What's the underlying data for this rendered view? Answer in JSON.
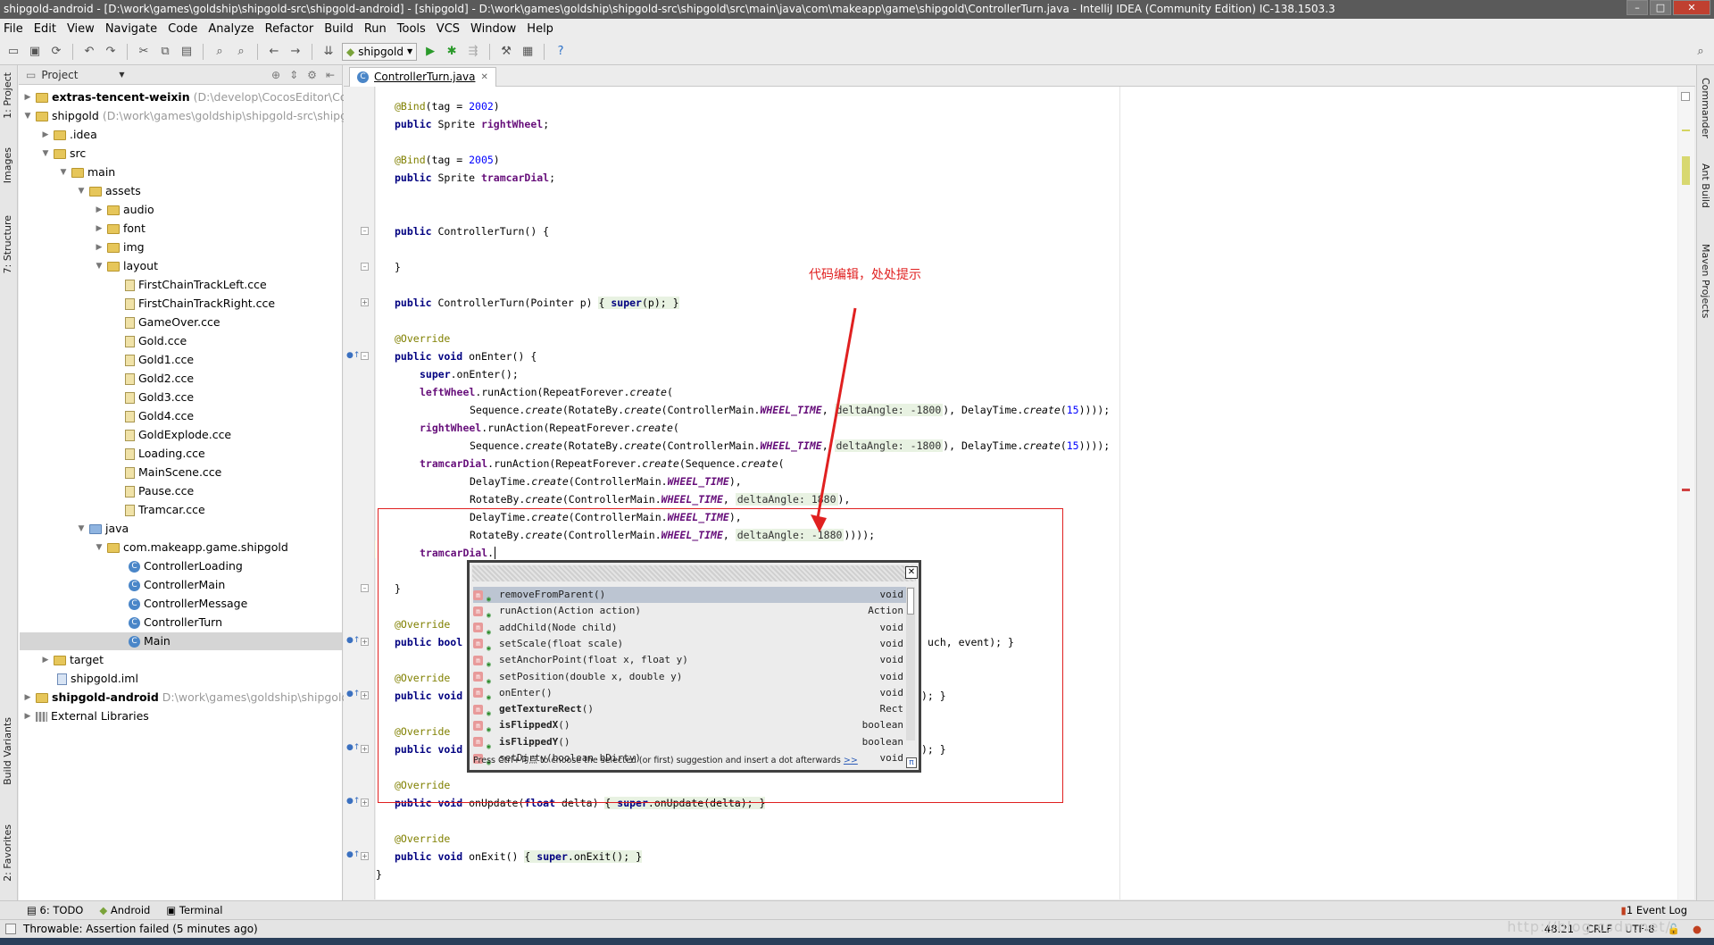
{
  "window": {
    "title": "shipgold-android - [D:\\work\\games\\goldship\\shipgold-src\\shipgold-android] - [shipgold] - D:\\work\\games\\goldship\\shipgold-src\\shipgold\\src\\main\\java\\com\\makeapp\\game\\shipgold\\ControllerTurn.java - IntelliJ IDEA (Community Edition) IC-138.1503.3"
  },
  "menu": [
    "File",
    "Edit",
    "View",
    "Navigate",
    "Code",
    "Analyze",
    "Refactor",
    "Build",
    "Run",
    "Tools",
    "VCS",
    "Window",
    "Help"
  ],
  "toolbar": {
    "run_config": "shipgold"
  },
  "left_tabs": [
    "1: Project",
    "Images",
    "7: Structure",
    "Build Variants",
    "2: Favorites"
  ],
  "right_tabs": [
    "Commander",
    "Ant Build",
    "Maven Projects"
  ],
  "project": {
    "header": "Project",
    "tree": [
      {
        "label": "extras-tencent-weixin",
        "path": "(D:\\develop\\CocosEditor\\Cocos",
        "bold": true
      },
      {
        "label": "shipgold",
        "path": "(D:\\work\\games\\goldship\\shipgold-src\\shipg",
        "bold": false
      },
      {
        "label": ".idea"
      },
      {
        "label": "src"
      },
      {
        "label": "main"
      },
      {
        "label": "assets"
      },
      {
        "label": "audio"
      },
      {
        "label": "font"
      },
      {
        "label": "img"
      },
      {
        "label": "layout"
      },
      {
        "label": "FirstChainTrackLeft.cce"
      },
      {
        "label": "FirstChainTrackRight.cce"
      },
      {
        "label": "GameOver.cce"
      },
      {
        "label": "Gold.cce"
      },
      {
        "label": "Gold1.cce"
      },
      {
        "label": "Gold2.cce"
      },
      {
        "label": "Gold3.cce"
      },
      {
        "label": "Gold4.cce"
      },
      {
        "label": "GoldExplode.cce"
      },
      {
        "label": "Loading.cce"
      },
      {
        "label": "MainScene.cce"
      },
      {
        "label": "Pause.cce"
      },
      {
        "label": "Tramcar.cce"
      },
      {
        "label": "java"
      },
      {
        "label": "com.makeapp.game.shipgold"
      },
      {
        "label": "ControllerLoading"
      },
      {
        "label": "ControllerMain"
      },
      {
        "label": "ControllerMessage"
      },
      {
        "label": "ControllerTurn"
      },
      {
        "label": "Main"
      },
      {
        "label": "target"
      },
      {
        "label": "shipgold.iml"
      },
      {
        "label": "shipgold-android",
        "path": "D:\\work\\games\\goldship\\shipgold",
        "bold": true
      },
      {
        "label": "External Libraries"
      }
    ]
  },
  "editor": {
    "tab": "ControllerTurn.java",
    "code": {
      "l1a": "@Bind",
      "l1b": "(tag = ",
      "l1c": "2002",
      "l1d": ")",
      "l2a": "public ",
      "l2b": "Sprite ",
      "l2c": "rightWheel",
      "l2d": ";",
      "l3a": "@Bind",
      "l3b": "(tag = ",
      "l3c": "2005",
      "l3d": ")",
      "l4a": "public ",
      "l4b": "Sprite ",
      "l4c": "tramcarDial",
      "l4d": ";",
      "l5a": "public ",
      "l5b": "ControllerTurn() {",
      "l6": "}",
      "l7a": "public ",
      "l7b": "ControllerTurn(Pointer p) ",
      "l7c": "{ ",
      "l7d": "super",
      "l7e": "(p); ",
      "l7f": "}",
      "l8": "@Override",
      "l9a": "public void ",
      "l9b": "onEnter() {",
      "l10a": "super",
      "l10b": ".onEnter();",
      "l11a": "leftWheel",
      ".": "",
      "l11b": ".runAction(RepeatForever.",
      "l11c": "create",
      "l11d": "(",
      "l12a": "Sequence.",
      "l12b": "create",
      "l12c": "(RotateBy.",
      "l12d": "create",
      "l12e": "(ControllerMain.",
      "l12f": "WHEEL_TIME",
      "l12g": ", ",
      "l12h": "deltaAngle: -1800",
      "l12i": "), DelayTime.",
      "l12j": "create",
      "l12k": "(",
      "l12l": "15",
      "l12m": "))));",
      "l13a": "rightWheel",
      "l13b": ".runAction(RepeatForever.",
      "l13c": "create",
      "l13d": "(",
      "l15a": "tramcarDial",
      "l15b": ".runAction(RepeatForever.",
      "l15c": "create",
      "l15d": "(Sequence.",
      "l15e": "create",
      "l15f": "(",
      "l16a": "DelayTime.",
      "l16b": "create",
      "l16c": "(ControllerMain.",
      "l16d": "WHEEL_TIME",
      "l16e": "),",
      "l17a": "RotateBy.",
      "l17b": "create",
      "l17c": "(ControllerMain.",
      "l17d": "WHEEL_TIME",
      "l17e": ", ",
      "l17f": "deltaAngle: 1880",
      "l17g": "),",
      "l19f": "deltaAngle: -1880",
      "l19g": "))));",
      "l20a": "tramcarDial",
      "l20b": ".",
      "l21": "}",
      "l22": "@Override",
      "l23a": "public bool",
      "l23tail": "uch, event); }",
      "l24": "@Override",
      "l25a": "public void",
      "l25tail": "); }",
      "l26": "@Override",
      "l27a": "public void",
      "l27tail": "); }",
      "l28": "@Override",
      "l29a": "public void ",
      "l29b": "onUpdate(",
      "l29c": "float ",
      "l29d": "delta) ",
      "l29e": "{ ",
      "l29f": "super",
      "l29g": ".onUpdate(delta); ",
      "l29h": "}",
      "l30": "@Override",
      "l31a": "public void ",
      "l31b": "onExit() ",
      "l31c": "{ ",
      "l31d": "super",
      "l31e": ".onExit(); ",
      "l31f": "}",
      "l32": "}"
    }
  },
  "annotation": "代码编辑，处处提示",
  "popup": {
    "items": [
      {
        "name": "removeFromParent",
        "args": "()",
        "ret": "void",
        "bold": false
      },
      {
        "name": "runAction",
        "args": "(Action action)",
        "ret": "Action",
        "bold": false
      },
      {
        "name": "addChild",
        "args": "(Node child)",
        "ret": "void",
        "bold": false
      },
      {
        "name": "setScale",
        "args": "(float scale)",
        "ret": "void",
        "bold": false
      },
      {
        "name": "setAnchorPoint",
        "args": "(float x, float y)",
        "ret": "void",
        "bold": false
      },
      {
        "name": "setPosition",
        "args": "(double x, double y)",
        "ret": "void",
        "bold": false
      },
      {
        "name": "onEnter",
        "args": "()",
        "ret": "void",
        "bold": false
      },
      {
        "name": "getTextureRect",
        "args": "()",
        "ret": "Rect",
        "bold": true
      },
      {
        "name": "isFlippedX",
        "args": "()",
        "ret": "boolean",
        "bold": true
      },
      {
        "name": "isFlippedY",
        "args": "()",
        "ret": "boolean",
        "bold": true
      },
      {
        "name": "setDirty",
        "args": "(boolean bDirty)",
        "ret": "void",
        "bold": false
      }
    ],
    "footer": "Press Ctrl+句点 to choose the selected (or first) suggestion and insert a dot afterwards",
    "footer_link": ">>",
    "pi": "π"
  },
  "bottom_tools": [
    "6: TODO",
    "Android",
    "Terminal"
  ],
  "event_log": "Event Log",
  "event_log_count": "1",
  "status": {
    "message": "Throwable: Assertion failed (5 minutes ago)",
    "position": "48:21",
    "line_sep": "CRLF",
    "encoding": "UTF-8"
  },
  "watermark": "http://blog.csdn.net/"
}
